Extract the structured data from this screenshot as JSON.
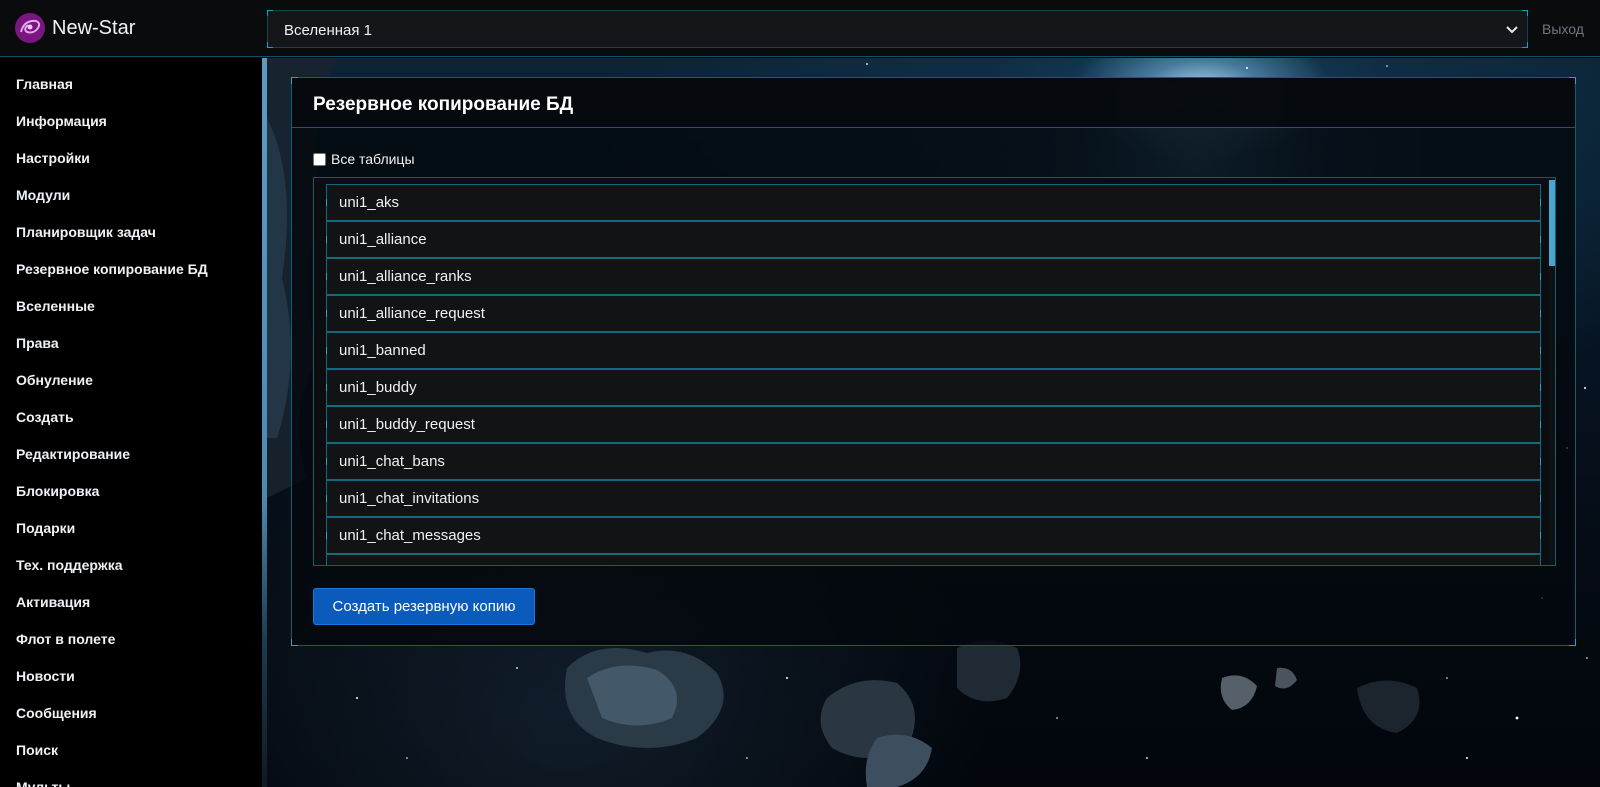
{
  "header": {
    "brand": "New-Star",
    "universe_select": {
      "value": "Вселенная 1"
    },
    "logout_label": "Выход"
  },
  "sidebar": {
    "items": [
      {
        "label": "Главная"
      },
      {
        "label": "Информация"
      },
      {
        "label": "Настройки"
      },
      {
        "label": "Модули"
      },
      {
        "label": "Планировщик задач"
      },
      {
        "label": "Резервное копирование БД"
      },
      {
        "label": "Вселенные"
      },
      {
        "label": "Права"
      },
      {
        "label": "Обнуление"
      },
      {
        "label": "Создать"
      },
      {
        "label": "Редактирование"
      },
      {
        "label": "Блокировка"
      },
      {
        "label": "Подарки"
      },
      {
        "label": "Тех. поддержка"
      },
      {
        "label": "Активация"
      },
      {
        "label": "Флот в полете"
      },
      {
        "label": "Новости"
      },
      {
        "label": "Сообщения"
      },
      {
        "label": "Поиск"
      },
      {
        "label": "Мульты"
      }
    ]
  },
  "main": {
    "title": "Резервное копирование БД",
    "all_tables_label": "Все таблицы",
    "all_tables_checked": false,
    "tables": [
      "uni1_aks",
      "uni1_alliance",
      "uni1_alliance_ranks",
      "uni1_alliance_request",
      "uni1_banned",
      "uni1_buddy",
      "uni1_buddy_request",
      "uni1_chat_bans",
      "uni1_chat_invitations",
      "uni1_chat_messages"
    ],
    "create_backup_label": "Создать резервную копию"
  },
  "colors": {
    "accent_border": "#19a9cf",
    "primary_button": "#0b5bbd",
    "brand_logo": "#8b1c8f"
  },
  "icons": {
    "logo": "galaxy-logo-icon",
    "select": "chevron-down-icon"
  }
}
